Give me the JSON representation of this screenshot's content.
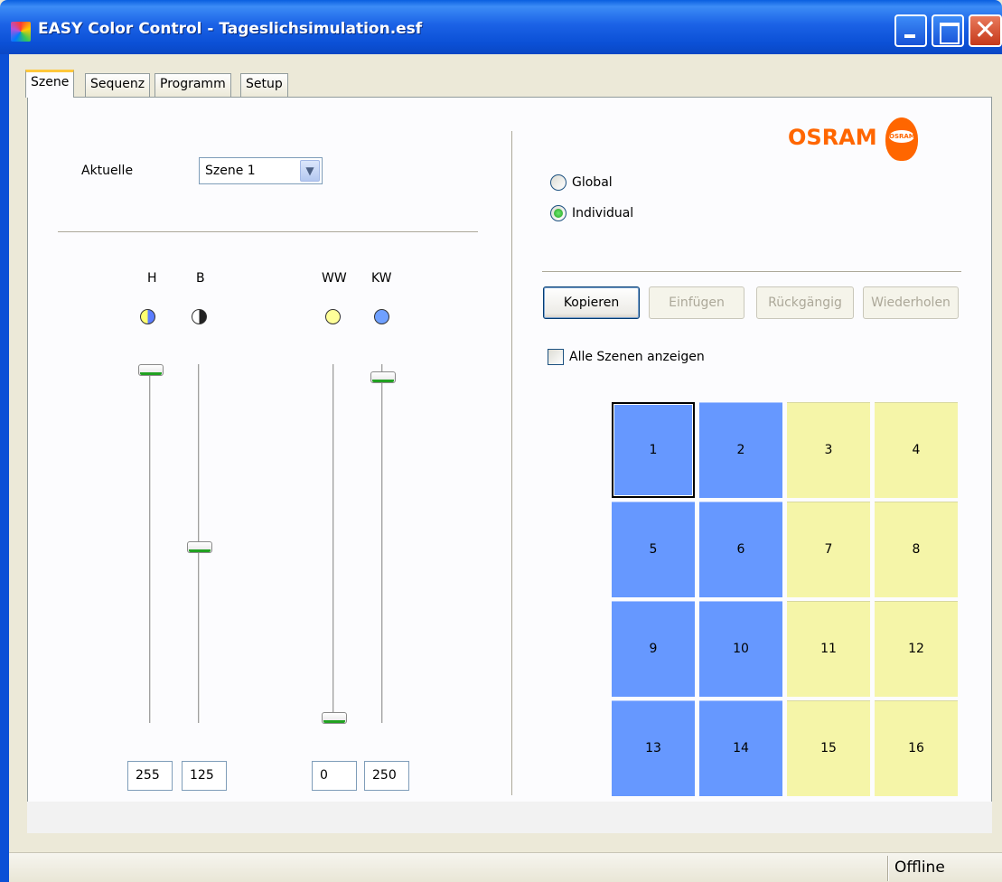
{
  "window": {
    "title": "EASY Color Control - Tageslichsimulation.esf",
    "accent_color": "#0b50d6"
  },
  "tabs": [
    {
      "label": "Szene",
      "active": true
    },
    {
      "label": "Sequenz",
      "active": false
    },
    {
      "label": "Programm",
      "active": false
    },
    {
      "label": "Setup",
      "active": false
    }
  ],
  "scene": {
    "current_label": "Aktuelle",
    "current_value": "Szene 1"
  },
  "sliders": [
    {
      "label": "H",
      "icon": "half-yellow-half-blue-circle-icon",
      "value": "255",
      "level": 1.0
    },
    {
      "label": "B",
      "icon": "half-white-half-black-circle-icon",
      "value": "125",
      "level": 0.49
    },
    {
      "label": "WW",
      "icon": "yellow-circle-icon",
      "value": "0",
      "level": 0.0
    },
    {
      "label": "KW",
      "icon": "blue-circle-icon",
      "value": "250",
      "level": 0.98
    }
  ],
  "logo": {
    "text": "OSRAM",
    "bulb_text": "OSRAM",
    "color": "#ff6600"
  },
  "mode": {
    "global_label": "Global",
    "individual_label": "Individual",
    "selected": "Individual"
  },
  "actions": {
    "copy_label": "Kopieren",
    "paste_label": "Einfügen",
    "undo_label": "Rückgängig",
    "redo_label": "Wiederholen"
  },
  "show_all_label": "Alle Szenen anzeigen",
  "channels": [
    {
      "label": "1",
      "color": "blue",
      "selected": true
    },
    {
      "label": "2",
      "color": "blue"
    },
    {
      "label": "3",
      "color": "yellow"
    },
    {
      "label": "4",
      "color": "yellow"
    },
    {
      "label": "5",
      "color": "blue"
    },
    {
      "label": "6",
      "color": "blue"
    },
    {
      "label": "7",
      "color": "yellow"
    },
    {
      "label": "8",
      "color": "yellow"
    },
    {
      "label": "9",
      "color": "blue"
    },
    {
      "label": "10",
      "color": "blue"
    },
    {
      "label": "11",
      "color": "yellow"
    },
    {
      "label": "12",
      "color": "yellow"
    },
    {
      "label": "13",
      "color": "blue"
    },
    {
      "label": "14",
      "color": "blue"
    },
    {
      "label": "15",
      "color": "yellow"
    },
    {
      "label": "16",
      "color": "yellow"
    }
  ],
  "channel_colors": {
    "blue": "#6698ff",
    "yellow": "#f5f5a8"
  },
  "status": {
    "text": "Offline"
  }
}
